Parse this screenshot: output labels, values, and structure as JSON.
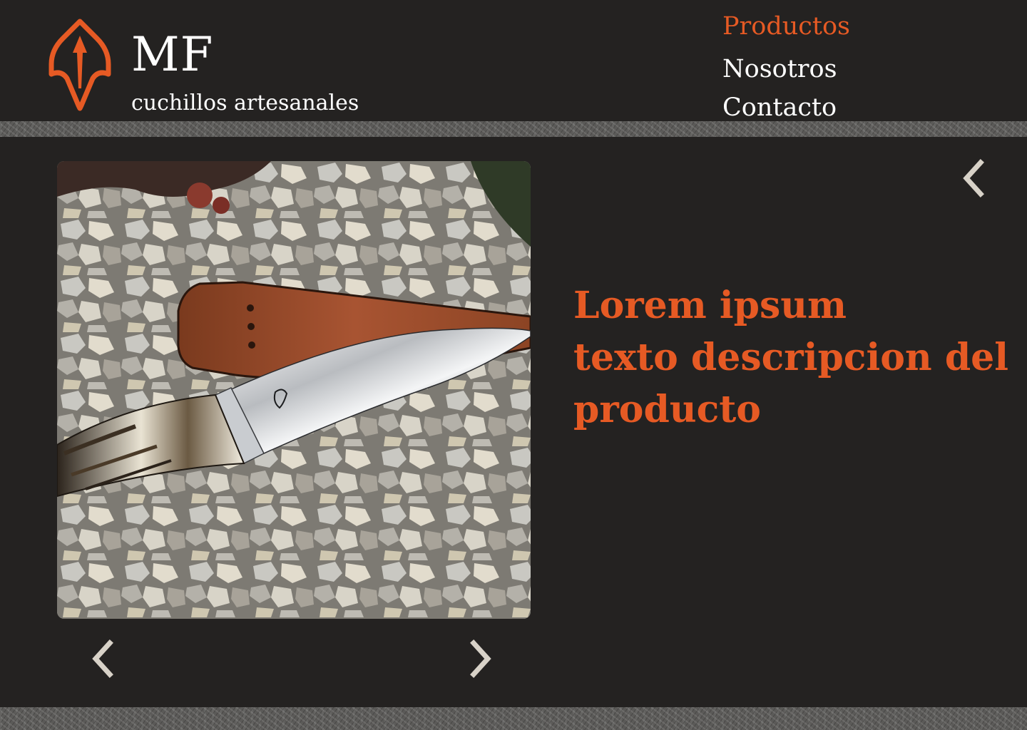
{
  "brand": {
    "title": "MF",
    "subtitle": "cuchillos artesanales",
    "logo_icon": "arrowhead-logo-icon"
  },
  "nav": {
    "items": [
      {
        "label": "Productos",
        "active": true
      },
      {
        "label": "Nosotros",
        "active": false
      },
      {
        "label": "Contacto",
        "active": false
      }
    ]
  },
  "product": {
    "description_lines": [
      "Lorem ipsum",
      "texto descripcion del",
      "producto"
    ]
  },
  "icons": {
    "back": "chevron-left-icon",
    "prev": "chevron-left-icon",
    "next": "chevron-right-icon"
  },
  "colors": {
    "accent": "#e65a24",
    "background": "#242221",
    "text": "#ffffff",
    "chevron": "#d8d2c8"
  }
}
